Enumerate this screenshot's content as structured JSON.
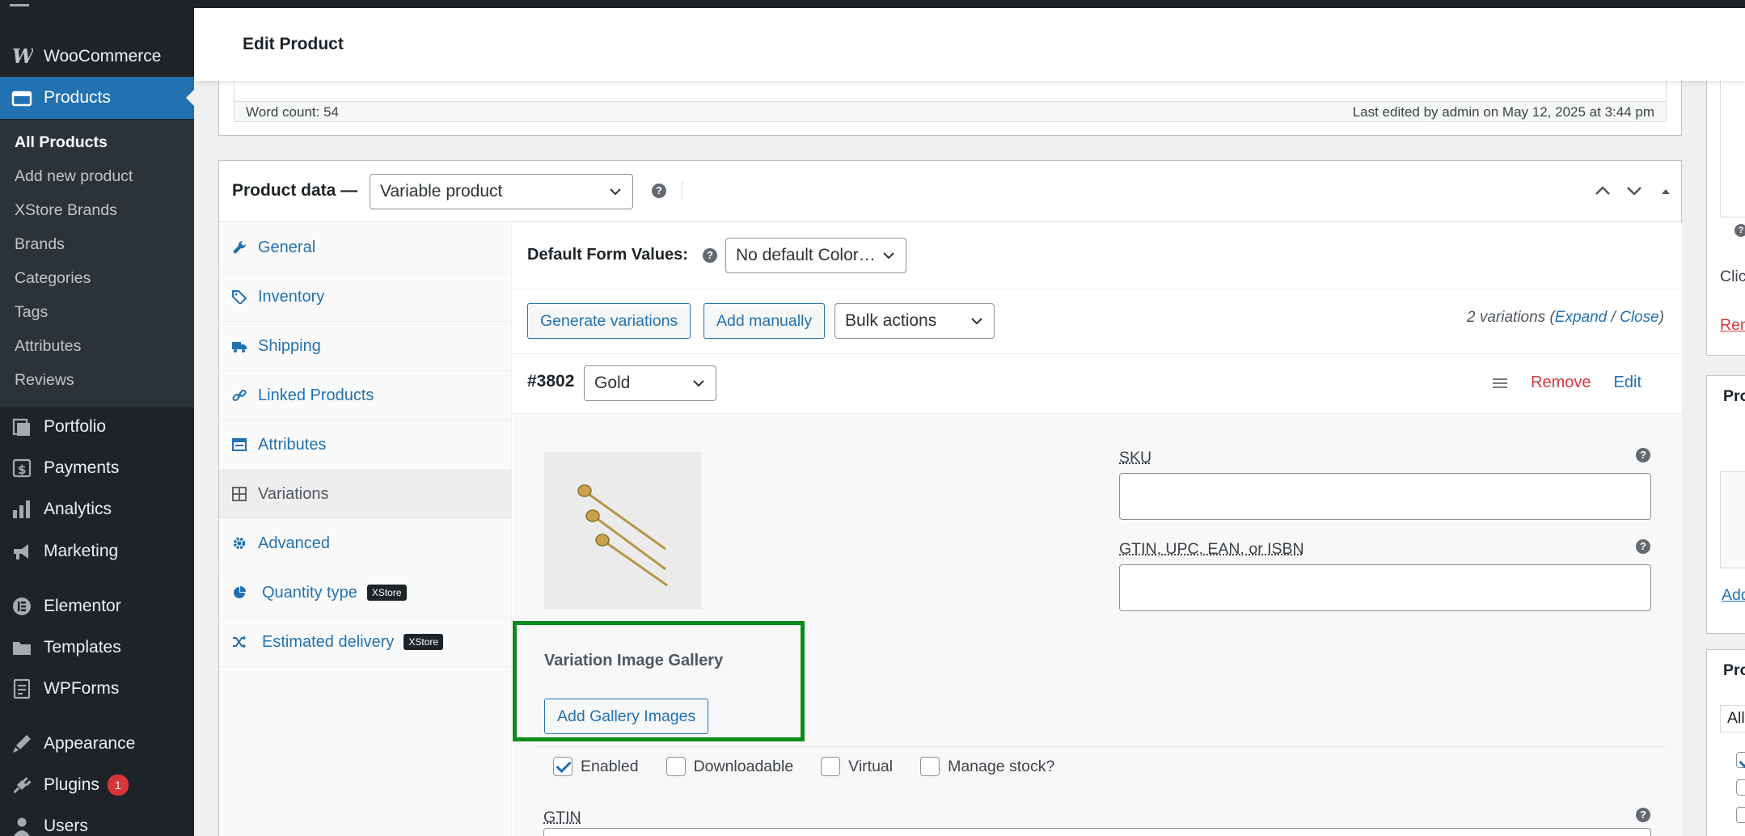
{
  "header": {
    "title": "Edit Product"
  },
  "sidebar": {
    "items": [
      {
        "label": "WooCommerce",
        "icon": "woocommerce-icon"
      },
      {
        "label": "Products",
        "icon": "products-icon"
      },
      {
        "label": "Portfolio",
        "icon": "portfolio-icon"
      },
      {
        "label": "Payments",
        "icon": "payments-icon"
      },
      {
        "label": "Analytics",
        "icon": "analytics-icon"
      },
      {
        "label": "Marketing",
        "icon": "marketing-icon"
      },
      {
        "label": "Elementor",
        "icon": "elementor-icon"
      },
      {
        "label": "Templates",
        "icon": "templates-icon"
      },
      {
        "label": "WPForms",
        "icon": "wpforms-icon"
      },
      {
        "label": "Appearance",
        "icon": "appearance-icon"
      },
      {
        "label": "Plugins",
        "icon": "plugins-icon",
        "badge": "1"
      },
      {
        "label": "Users",
        "icon": "users-icon"
      }
    ],
    "submenu": [
      "All Products",
      "Add new product",
      "XStore Brands",
      "Brands",
      "Categories",
      "Tags",
      "Attributes",
      "Reviews"
    ]
  },
  "editor": {
    "word_count": "Word count: 54",
    "last_edited": "Last edited by admin on May 12, 2025 at 3:44 pm"
  },
  "product_data": {
    "label": "Product data —",
    "type_select": "Variable product",
    "tabs": [
      {
        "label": "General"
      },
      {
        "label": "Inventory"
      },
      {
        "label": "Shipping"
      },
      {
        "label": "Linked Products"
      },
      {
        "label": "Attributes"
      },
      {
        "label": "Variations"
      },
      {
        "label": "Advanced"
      },
      {
        "label": "Quantity type",
        "badge": "XStore"
      },
      {
        "label": "Estimated delivery",
        "badge": "XStore"
      }
    ]
  },
  "variations": {
    "default_label": "Default Form Values:",
    "default_select": "No default Color…",
    "generate_btn": "Generate variations",
    "add_btn": "Add manually",
    "bulk_select": "Bulk actions",
    "count_text": "2 variations (",
    "expand": "Expand",
    "slash": " / ",
    "close": "Close",
    "count_end": ")",
    "variation": {
      "id": "#3802",
      "color_select": "Gold",
      "remove": "Remove",
      "edit": "Edit",
      "gallery_title": "Variation Image Gallery",
      "gallery_btn": "Add Gallery Images",
      "sku_label": "SKU",
      "gtin_label": "GTIN, UPC, EAN, or ISBN",
      "checkboxes": [
        {
          "label": "Enabled",
          "checked": true
        },
        {
          "label": "Downloadable",
          "checked": false
        },
        {
          "label": "Virtual",
          "checked": false
        },
        {
          "label": "Manage stock?",
          "checked": false
        }
      ],
      "gtin2_label": "GTIN"
    }
  },
  "right_column": {
    "clip_text_1": "Clic",
    "clip_text_2": "Rem",
    "clip_text_3": "Pro",
    "clip_text_4": "Add",
    "clip_text_5": "Pro",
    "clip_text_6": "All"
  },
  "colors": {
    "accent": "#2271b1",
    "highlight": "#0a8a1a",
    "sidebar": "#1d2327",
    "remove": "#d63638"
  }
}
